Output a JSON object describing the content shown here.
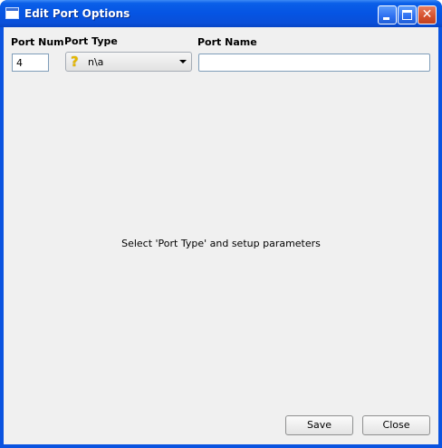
{
  "window": {
    "title": "Edit Port Options",
    "controls": {
      "minimize": "minimize-icon",
      "maximize": "maximize-icon",
      "close": "close-icon"
    }
  },
  "form": {
    "port_num_label": "Port Num",
    "port_num_value": "4",
    "port_type_label": "Port Type",
    "port_type_selected": "n\\a",
    "port_type_icon": "question-mark-icon",
    "port_name_label": "Port Name",
    "port_name_value": ""
  },
  "main": {
    "hint": "Select 'Port Type' and setup parameters"
  },
  "buttons": {
    "save": "Save",
    "close": "Close"
  },
  "colors": {
    "titlebar": "#0554e3",
    "client_bg": "#f0f0f0",
    "close_button": "#d5512d"
  }
}
